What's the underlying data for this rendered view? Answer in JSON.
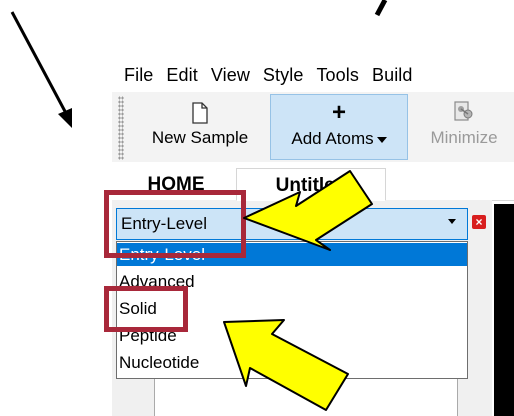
{
  "menu": [
    "File",
    "Edit",
    "View",
    "Style",
    "Tools",
    "Build"
  ],
  "toolbar": {
    "new_sample": "New Sample",
    "add_atoms": "Add Atoms",
    "minimize": "Minimize"
  },
  "tabs": [
    {
      "label": "HOME"
    },
    {
      "label": "Untitled"
    }
  ],
  "combo": {
    "value": "Entry-Level"
  },
  "dropdown": {
    "options": [
      "Entry-Level",
      "Advanced",
      "Solid",
      "Peptide",
      "Nucleotide"
    ],
    "selected_index": 0
  },
  "colors": {
    "highlight_border": "#a8283a",
    "annotation_arrow": "#ffff00",
    "selection": "#0078d7",
    "combo_bg": "#cce4f7",
    "close_button": "#d81e1e"
  },
  "icons": [
    "document-icon",
    "plus-icon",
    "minimize-molecule-icon",
    "chevron-down-icon",
    "close-icon"
  ]
}
